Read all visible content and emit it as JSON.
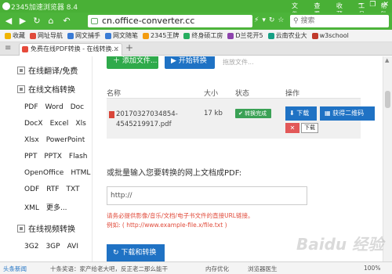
{
  "titlebar": {
    "title": "2345加速浏览器 8.4",
    "menus": [
      "文件",
      "查看",
      "收藏",
      "工具",
      "帮助"
    ],
    "window_buttons": [
      "─",
      "❐",
      "✕"
    ]
  },
  "addressbar": {
    "url": "cn.office-converter.cc",
    "search_placeholder": "搜索"
  },
  "bookmarks": [
    {
      "label": "收藏",
      "color": "#f0b400"
    },
    {
      "label": "网址导航",
      "color": "#e04a3a"
    },
    {
      "label": "网文捕手",
      "color": "#3a7bd5"
    },
    {
      "label": "网文随笔",
      "color": "#3a7bd5"
    },
    {
      "label": "2345王牌",
      "color": "#f39c12"
    },
    {
      "label": "终身硕工房",
      "color": "#27ae60"
    },
    {
      "label": "D兰花开5",
      "color": "#8e44ad"
    },
    {
      "label": "云南农业大",
      "color": "#16a085"
    },
    {
      "label": "w3school",
      "color": "#c0392b"
    }
  ],
  "tab": {
    "label": "免费在线PDF转换 - 在线转换..."
  },
  "sidebar": {
    "sections": [
      {
        "label": "在线翻译/免费"
      },
      {
        "label": "在线文档转换"
      },
      {
        "label": "在线视频转换"
      }
    ],
    "doc_formats": [
      [
        "PDF",
        "Word",
        "Doc"
      ],
      [
        "DocX",
        "Excel",
        "Xls"
      ],
      [
        "Xlsx",
        "PowerPoint"
      ],
      [
        "PPT",
        "PPTX",
        "Flash"
      ],
      [
        "OpenOffice",
        "HTML"
      ],
      [
        "ODF",
        "RTF",
        "TXT"
      ],
      [
        "XML",
        "更多..."
      ]
    ],
    "video_formats": [
      [
        "3G2",
        "3GP",
        "AVI"
      ]
    ]
  },
  "main": {
    "add_file_label": "添加文件...",
    "start_label": "开始转换",
    "hint": "拖放文件...",
    "table_headers": {
      "name": "名称",
      "size": "大小",
      "status": "状态",
      "action": "操作"
    },
    "file": {
      "name_line1": "20170327034854-",
      "name_line2": "4545219917.pdf",
      "size": "17 kb",
      "status": "转换完成",
      "download_label": "下载",
      "qrcode_label": "获得二维码",
      "delete_label": "✕",
      "tooltip": "下载"
    },
    "url_prompt": "或批量输入您要转换的网上文档成PDF:",
    "url_input_value": "http://",
    "warning_line1": "请务必提供影像/音乐/文档/电子书文件的直接URL链接。",
    "warning_line2": "例如: ( http://www.example-file.x/file.txt )",
    "download_convert_label": "下载和转换"
  },
  "statusbar": {
    "left": "头条新闻",
    "news": "十条奖语：家产给老大吧，反正老二那么能干",
    "memory": "内存优化",
    "doctor": "浏览器医生",
    "zoom": "100%"
  },
  "watermark": "Baidu 经验"
}
